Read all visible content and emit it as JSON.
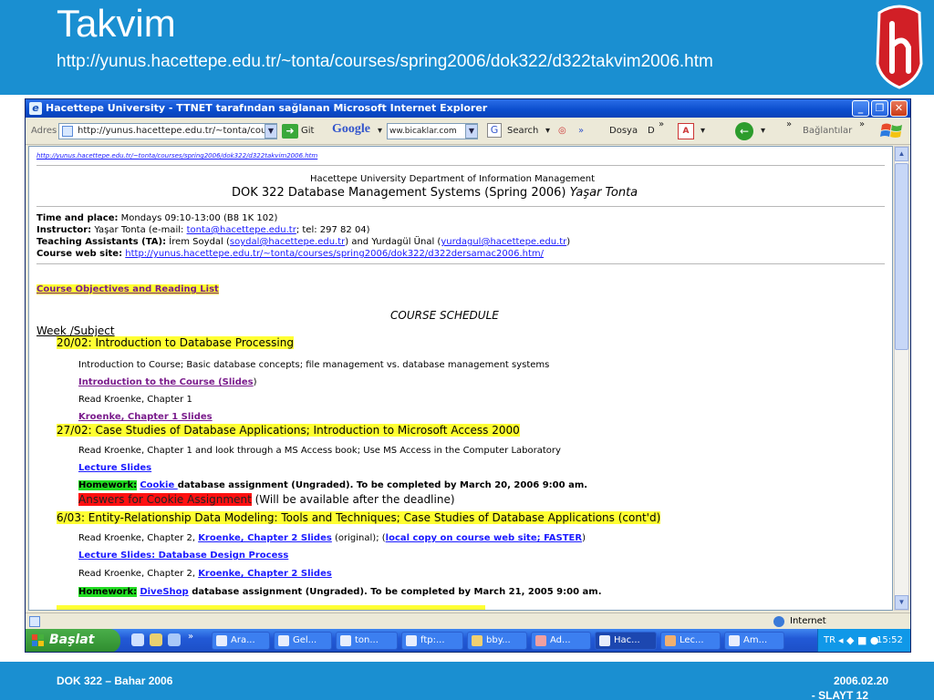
{
  "slide": {
    "title": "Takvim",
    "subtitle": "http://yunus.hacettepe.edu.tr/~tonta/courses/spring2006/dok322/d322takvim2006.htm",
    "footer_left": "DOK 322 – Bahar 2006",
    "footer_date": "2006.02.20",
    "footer_slide": "- SLAYT 12"
  },
  "browser": {
    "window_title": "Hacettepe University - TTNET tarafından sağlanan Microsoft Internet Explorer",
    "address_label": "Adres",
    "address_value": "http://yunus.hacettepe.edu.tr/~tonta/cour:",
    "go_label": "Git",
    "google_label": "Google",
    "search_value": "ww.bicaklar.com",
    "search_label": "Search",
    "dosya_label": "Dosya",
    "dosya_fragment": "D",
    "links_label": "Bağlantılar",
    "status_zone": "Internet"
  },
  "page": {
    "top_url": "http://yunus.hacettepe.edu.tr/~tonta/courses/spring2006/dok322/d322takvim2006.htm",
    "dept": "Hacettepe University Department of Information Management",
    "course_title": "DOK 322 Database Management Systems (",
    "course_term": "Spring 2006",
    "course_close": ")",
    "instructor_name": "Yaşar Tonta",
    "time_label": "Time and place:",
    "time_value": "Mondays 09:10-13:00 (B8 1K 102)",
    "instructor_label": "Instructor:",
    "instructor_value_a": "Yaşar Tonta (e-mail:",
    "instructor_email": "tonta@hacettepe.edu.tr",
    "instructor_value_b": "; tel: 297 82 04)",
    "ta_label": "Teaching Assistants (TA):",
    "ta_a": "İrem Soydal (",
    "ta_email1": "soydal@hacettepe.edu.tr",
    "ta_b": ") and Yurdagül Ünal (",
    "ta_email2": "yurdagul@hacettepe.edu.tr",
    "ta_c": ")",
    "web_label": "Course web site:",
    "web_link": "http://yunus.hacettepe.edu.tr/~tonta/courses/spring2006/dok322/d322dersamac2006.htm/",
    "objectives_link": "Course Objectives and Reading List",
    "schedule_heading": "COURSE SCHEDULE",
    "week_subject": "Week /Subject",
    "w1_title": "20/02: Introduction to Database Processing",
    "w1_desc": "Introduction to Course; Basic database concepts; file management vs. database management systems",
    "w1_link1": "Introduction to the Course (Slides",
    "w1_link1_close": ")",
    "w1_read": "Read Kroenke, Chapter 1",
    "w1_link2": "Kroenke, Chapter 1 Slides",
    "w2_title": "27/02: Case Studies of Database Applications; Introduction to Microsoft Access 2000",
    "w2_read": "Read Kroenke, Chapter 1 and look through a MS Access book; Use MS Access in the Computer Laboratory",
    "w2_lecture": "Lecture Slides",
    "w2_hw_label": "Homework:",
    "w2_hw_link": "Cookie ",
    "w2_hw_text": " database assignment (Ungraded).  To be completed by March 20, 2006 9:00 am.",
    "w2_answers": "Answers for Cookie Assignment",
    "w2_answers_note": " (Will be available after the deadline)",
    "w3_title": "6/03: Entity-Relationship Data Modeling: Tools and Techniques; Case Studies of Database Applications (cont'd)",
    "w3_read_a": "Read Kroenke, Chapter 2, ",
    "w3_read_link": "Kroenke, Chapter 2 Slides",
    "w3_read_b": " (original);  (",
    "w3_read_link2": "local copy on course web site; FASTER",
    "w3_read_c": ")",
    "w3_lecture": "Lecture Slides: Database Design Process",
    "w3_read2_a": "Read Kroenke, Chapter 2, ",
    "w3_read2_link": "Kroenke, Chapter 2 Slides",
    "w3_hw_label": "Homework:",
    "w3_hw_link": "DiveShop",
    "w3_hw_text": " database assignment (Ungraded).  To be completed by March 21, 2005 9:00 am."
  },
  "taskbar": {
    "start_label": "Başlat",
    "tasks": [
      "Ara...",
      "Gel...",
      "ton...",
      "ftp:...",
      "bby...",
      "Ad...",
      "Hac...",
      "Lec...",
      "Am..."
    ],
    "lang": "TR",
    "clock": "15:52"
  }
}
